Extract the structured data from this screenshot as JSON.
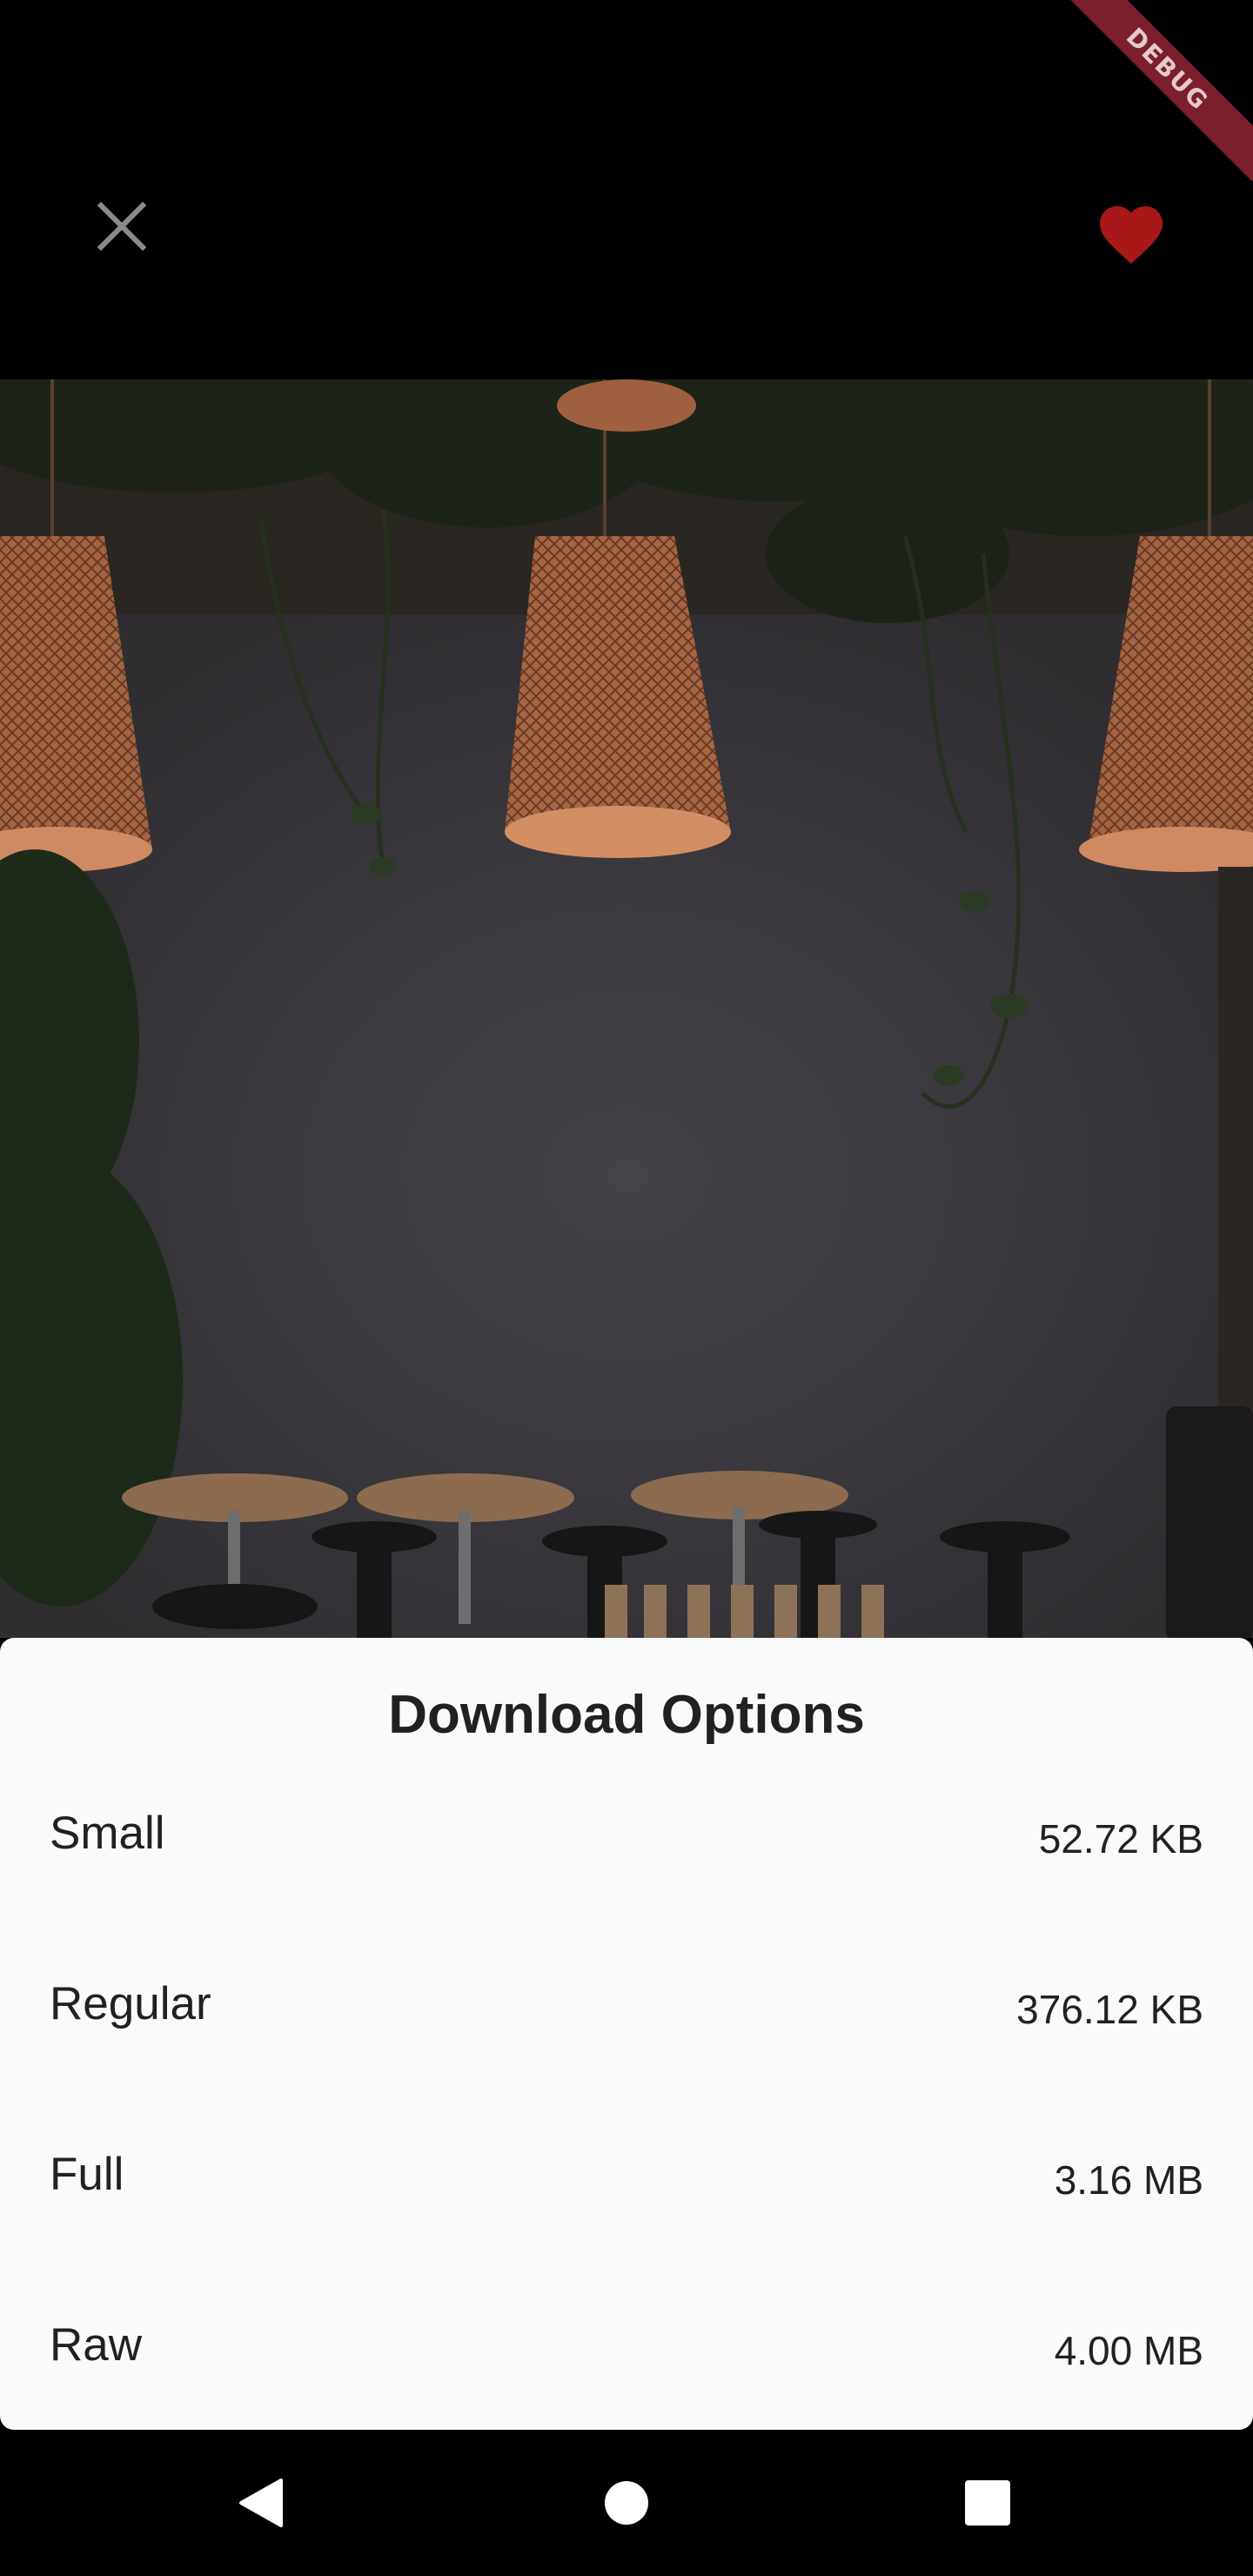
{
  "top_bar": {
    "close_icon": "close-icon",
    "favorite_icon": "heart-icon",
    "favorite_color": "#b71c1c",
    "debug_label": "DEBUG"
  },
  "sheet": {
    "title": "Download Options",
    "options": [
      {
        "name": "Small",
        "size": "52.72 KB"
      },
      {
        "name": "Regular",
        "size": "376.12 KB"
      },
      {
        "name": "Full",
        "size": "3.16 MB"
      },
      {
        "name": "Raw",
        "size": "4.00 MB"
      }
    ]
  },
  "navbar": {
    "back_icon": "back-triangle-icon",
    "home_icon": "home-circle-icon",
    "recents_icon": "recents-square-icon"
  }
}
